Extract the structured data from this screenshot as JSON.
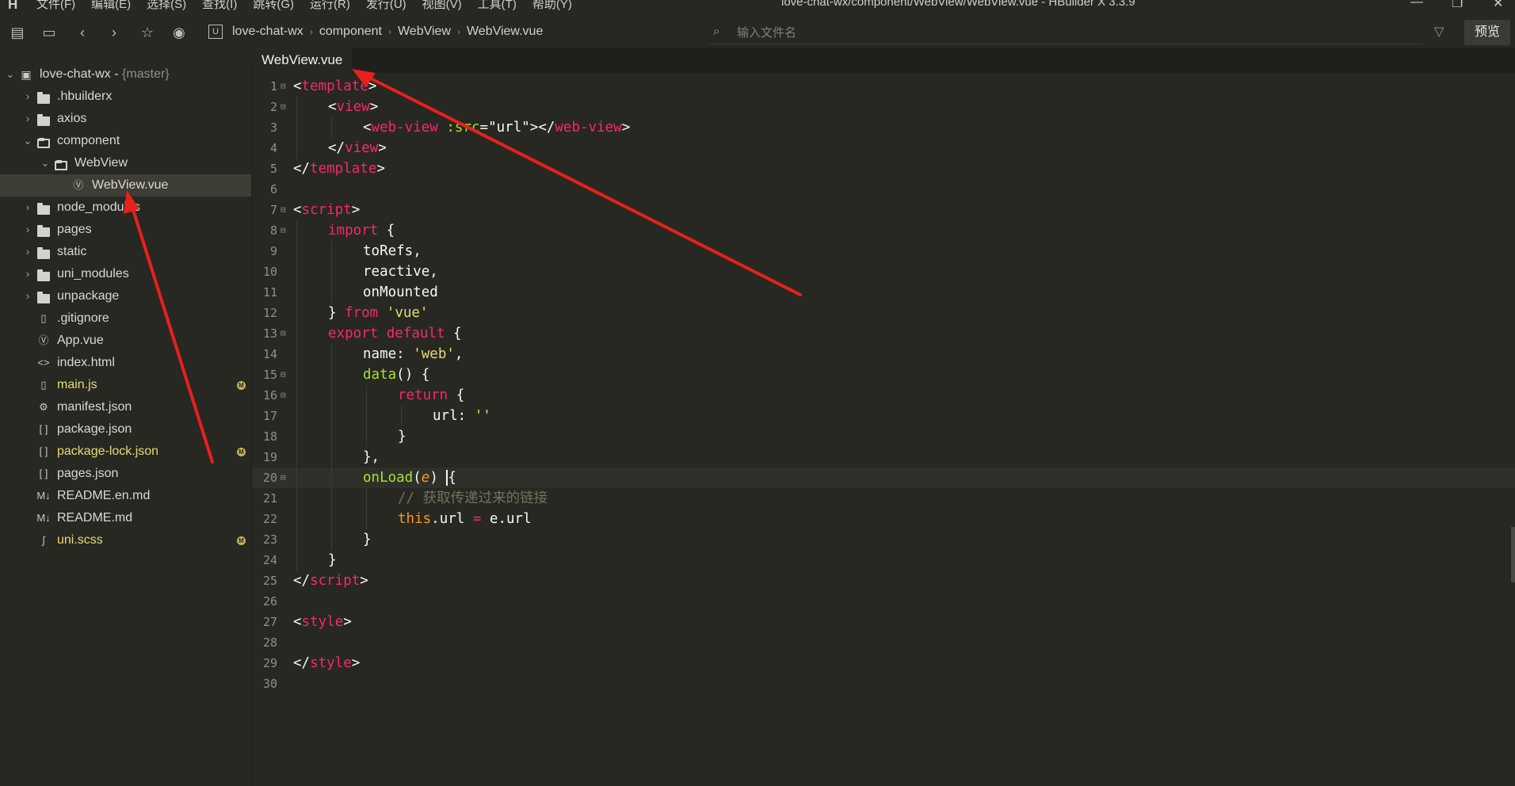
{
  "app": {
    "logo": "H",
    "window_title": "love-chat-wx/component/WebView/WebView.vue - HBuilder X 3.3.9",
    "menu": [
      "文件(F)",
      "编辑(E)",
      "选择(S)",
      "查找(I)",
      "跳转(G)",
      "运行(R)",
      "发行(U)",
      "视图(V)",
      "工具(T)",
      "帮助(Y)"
    ],
    "window_controls": {
      "minimize": "—",
      "maximize": "❐",
      "close": "✕"
    }
  },
  "toolbar": {
    "breadcrumbs": [
      "love-chat-wx",
      "component",
      "WebView",
      "WebView.vue"
    ],
    "file_search_placeholder": "输入文件名",
    "preview_label": "预览"
  },
  "sidebar": {
    "project_name": "love-chat-wx",
    "branch": "{master}",
    "items": [
      {
        "label": ".hbuilderx",
        "type": "folder",
        "depth": 1,
        "expanded": false
      },
      {
        "label": "axios",
        "type": "folder",
        "depth": 1,
        "expanded": false
      },
      {
        "label": "component",
        "type": "folder",
        "depth": 1,
        "expanded": true
      },
      {
        "label": "WebView",
        "type": "folder",
        "depth": 2,
        "expanded": true
      },
      {
        "label": "WebView.vue",
        "type": "vue",
        "depth": 3,
        "selected": true
      },
      {
        "label": "node_modules",
        "type": "folder",
        "depth": 1,
        "expanded": false
      },
      {
        "label": "pages",
        "type": "folder",
        "depth": 1,
        "expanded": false
      },
      {
        "label": "static",
        "type": "folder",
        "depth": 1,
        "expanded": false
      },
      {
        "label": "uni_modules",
        "type": "folder",
        "depth": 1,
        "expanded": false
      },
      {
        "label": "unpackage",
        "type": "folder",
        "depth": 1,
        "expanded": false
      },
      {
        "label": ".gitignore",
        "type": "file",
        "depth": 1
      },
      {
        "label": "App.vue",
        "type": "vue",
        "depth": 1
      },
      {
        "label": "index.html",
        "type": "html",
        "depth": 1
      },
      {
        "label": "main.js",
        "type": "js",
        "depth": 1,
        "modified": true,
        "badge": "M"
      },
      {
        "label": "manifest.json",
        "type": "manifest",
        "depth": 1
      },
      {
        "label": "package.json",
        "type": "json",
        "depth": 1
      },
      {
        "label": "package-lock.json",
        "type": "json",
        "depth": 1,
        "modified": true,
        "badge": "M"
      },
      {
        "label": "pages.json",
        "type": "json",
        "depth": 1
      },
      {
        "label": "README.en.md",
        "type": "md",
        "depth": 1
      },
      {
        "label": "README.md",
        "type": "md",
        "depth": 1
      },
      {
        "label": "uni.scss",
        "type": "scss",
        "depth": 1,
        "modified": true,
        "badge": "M"
      }
    ]
  },
  "editor": {
    "active_tab": "WebView.vue",
    "current_line": 20,
    "lines": [
      {
        "n": "1",
        "fold": "⊟",
        "indent": 0,
        "tokens": [
          [
            "punc",
            "<"
          ],
          [
            "tag",
            "template"
          ],
          [
            "punc",
            ">"
          ]
        ]
      },
      {
        "n": "2",
        "fold": "⊟",
        "indent": 1,
        "tokens": [
          [
            "punc",
            "<"
          ],
          [
            "tag",
            "view"
          ],
          [
            "punc",
            ">"
          ]
        ]
      },
      {
        "n": "3",
        "fold": "",
        "indent": 2,
        "tokens": [
          [
            "punc",
            "<"
          ],
          [
            "tag",
            "web-view"
          ],
          [
            "punc",
            " "
          ],
          [
            "attr",
            ":src"
          ],
          [
            "punc",
            "="
          ],
          [
            "punc",
            "\"url\""
          ],
          [
            "punc",
            "></"
          ],
          [
            "tag",
            "web-view"
          ],
          [
            "punc",
            ">"
          ]
        ]
      },
      {
        "n": "4",
        "fold": "",
        "indent": 1,
        "tokens": [
          [
            "punc",
            "</"
          ],
          [
            "tag",
            "view"
          ],
          [
            "punc",
            ">"
          ]
        ]
      },
      {
        "n": "5",
        "fold": "",
        "indent": 0,
        "tokens": [
          [
            "punc",
            "</"
          ],
          [
            "tag",
            "template"
          ],
          [
            "punc",
            ">"
          ]
        ]
      },
      {
        "n": "6",
        "fold": "",
        "indent": 0,
        "tokens": []
      },
      {
        "n": "7",
        "fold": "⊟",
        "indent": 0,
        "tokens": [
          [
            "punc",
            "<"
          ],
          [
            "tag",
            "script"
          ],
          [
            "punc",
            ">"
          ]
        ]
      },
      {
        "n": "8",
        "fold": "⊟",
        "indent": 1,
        "tokens": [
          [
            "kw",
            "import"
          ],
          [
            "punc",
            " {"
          ]
        ]
      },
      {
        "n": "9",
        "fold": "",
        "indent": 2,
        "tokens": [
          [
            "punc",
            "toRefs,"
          ]
        ]
      },
      {
        "n": "10",
        "fold": "",
        "indent": 2,
        "tokens": [
          [
            "punc",
            "reactive,"
          ]
        ]
      },
      {
        "n": "11",
        "fold": "",
        "indent": 2,
        "tokens": [
          [
            "punc",
            "onMounted"
          ]
        ]
      },
      {
        "n": "12",
        "fold": "",
        "indent": 1,
        "tokens": [
          [
            "punc",
            "} "
          ],
          [
            "kw",
            "from"
          ],
          [
            "punc",
            " "
          ],
          [
            "str",
            "'vue'"
          ]
        ]
      },
      {
        "n": "13",
        "fold": "⊟",
        "indent": 1,
        "tokens": [
          [
            "kw",
            "export default"
          ],
          [
            "punc",
            " {"
          ]
        ]
      },
      {
        "n": "14",
        "fold": "",
        "indent": 2,
        "tokens": [
          [
            "punc",
            "name: "
          ],
          [
            "str",
            "'web'"
          ],
          [
            "punc",
            ","
          ]
        ]
      },
      {
        "n": "15",
        "fold": "⊟",
        "indent": 2,
        "tokens": [
          [
            "fn",
            "data"
          ],
          [
            "punc",
            "() {"
          ]
        ]
      },
      {
        "n": "16",
        "fold": "⊟",
        "indent": 3,
        "tokens": [
          [
            "kw",
            "return"
          ],
          [
            "punc",
            " {"
          ]
        ]
      },
      {
        "n": "17",
        "fold": "",
        "indent": 4,
        "tokens": [
          [
            "punc",
            "url: "
          ],
          [
            "str",
            "''"
          ]
        ]
      },
      {
        "n": "18",
        "fold": "",
        "indent": 3,
        "tokens": [
          [
            "punc",
            "}"
          ]
        ]
      },
      {
        "n": "19",
        "fold": "",
        "indent": 2,
        "tokens": [
          [
            "punc",
            "},"
          ]
        ]
      },
      {
        "n": "20",
        "fold": "⊟",
        "indent": 2,
        "tokens": [
          [
            "fn",
            "onLoad"
          ],
          [
            "punc",
            "("
          ],
          [
            "param",
            "e"
          ],
          [
            "punc",
            ") "
          ],
          [
            "cursor",
            "{"
          ]
        ]
      },
      {
        "n": "21",
        "fold": "",
        "indent": 3,
        "tokens": [
          [
            "cm",
            "// 获取传递过来的链接"
          ]
        ]
      },
      {
        "n": "22",
        "fold": "",
        "indent": 3,
        "tokens": [
          [
            "this",
            "this"
          ],
          [
            "punc",
            ".url "
          ],
          [
            "kw",
            "="
          ],
          [
            "punc",
            " e.url"
          ]
        ]
      },
      {
        "n": "23",
        "fold": "",
        "indent": 2,
        "tokens": [
          [
            "punc",
            "}"
          ]
        ]
      },
      {
        "n": "24",
        "fold": "",
        "indent": 1,
        "tokens": [
          [
            "punc",
            "}"
          ]
        ]
      },
      {
        "n": "25",
        "fold": "",
        "indent": 0,
        "tokens": [
          [
            "punc",
            "</"
          ],
          [
            "tag",
            "script"
          ],
          [
            "punc",
            ">"
          ]
        ]
      },
      {
        "n": "26",
        "fold": "",
        "indent": 0,
        "tokens": []
      },
      {
        "n": "27",
        "fold": "",
        "indent": 0,
        "tokens": [
          [
            "punc",
            "<"
          ],
          [
            "tag",
            "style"
          ],
          [
            "punc",
            ">"
          ]
        ]
      },
      {
        "n": "28",
        "fold": "",
        "indent": 0,
        "tokens": []
      },
      {
        "n": "29",
        "fold": "",
        "indent": 0,
        "tokens": [
          [
            "punc",
            "</"
          ],
          [
            "tag",
            "style"
          ],
          [
            "punc",
            ">"
          ]
        ]
      },
      {
        "n": "30",
        "fold": "",
        "indent": 0,
        "tokens": []
      }
    ]
  },
  "colors": {
    "background": "#272822",
    "keyword": "#f92672",
    "function": "#a6e22e",
    "string": "#e6db74",
    "comment": "#75715e",
    "annotation_arrow": "#e8201e"
  }
}
